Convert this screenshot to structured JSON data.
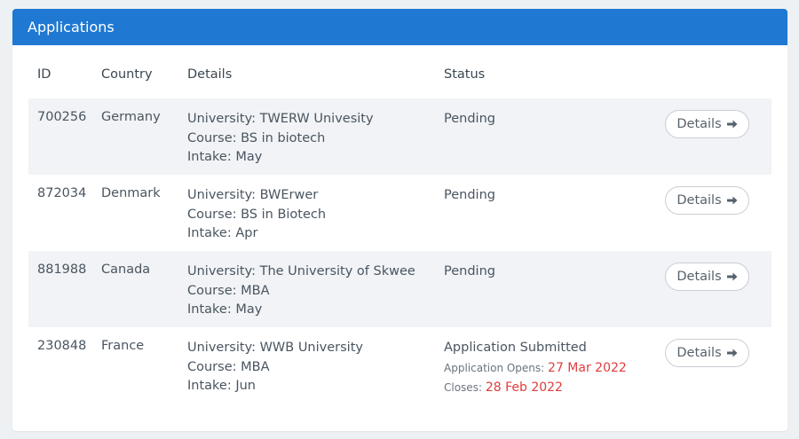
{
  "header": {
    "title": "Applications"
  },
  "table": {
    "columns": [
      "ID",
      "Country",
      "Details",
      "Status"
    ],
    "rows": [
      {
        "id": "700256",
        "country": "Germany",
        "university": "University: TWERW Univesity",
        "course": "Course: BS in biotech",
        "intake": "Intake: May",
        "status": "Pending",
        "button": "Details"
      },
      {
        "id": "872034",
        "country": "Denmark",
        "university": "University: BWErwer",
        "course": "Course: BS in Biotech",
        "intake": "Intake: Apr",
        "status": "Pending",
        "button": "Details"
      },
      {
        "id": "881988",
        "country": "Canada",
        "university": "University: The University of Skwee",
        "course": "Course: MBA",
        "intake": "Intake: May",
        "status": "Pending",
        "button": "Details"
      },
      {
        "id": "230848",
        "country": "France",
        "university": "University: WWB University",
        "course": "Course: MBA",
        "intake": "Intake: Jun",
        "status": "Application Submitted",
        "opens_label": "Application Opens:",
        "opens_date": "27 Mar 2022",
        "closes_label": "Closes:",
        "closes_date": "28 Feb 2022",
        "button": "Details"
      }
    ]
  },
  "colors": {
    "header_bg": "#1f78d1",
    "date_red": "#e03c3c",
    "row_alt_bg": "#f1f3f6"
  },
  "icons": {
    "button_arrow": "arrow-right-icon"
  }
}
